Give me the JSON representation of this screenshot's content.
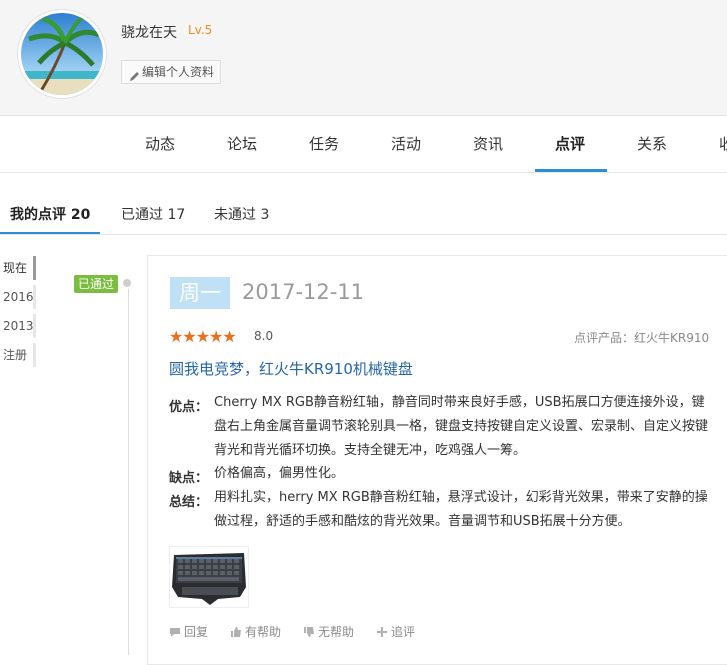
{
  "profile": {
    "username": "骁龙在天",
    "level": "Lv.5",
    "edit_label": "编辑个人资料"
  },
  "nav": {
    "tabs": [
      {
        "label": "动态"
      },
      {
        "label": "论坛"
      },
      {
        "label": "任务"
      },
      {
        "label": "活动"
      },
      {
        "label": "资讯"
      },
      {
        "label": "点评",
        "active": true
      },
      {
        "label": "关系"
      },
      {
        "label": "收"
      }
    ]
  },
  "subtabs": {
    "my_reviews": "我的点评 20",
    "approved": "已通过 17",
    "not_approved": "未通过 3"
  },
  "years": [
    "现在",
    "2016",
    "2013",
    "注册"
  ],
  "review": {
    "status": "已通过",
    "weekday": "周一",
    "date": "2017-12-11",
    "stars": "★★★★★",
    "rating": 8.0,
    "score": "8.0",
    "product_label": "点评产品：红火牛KR910",
    "title": "圆我电竞梦，红火牛KR910机械键盘",
    "pros_label": "优点：",
    "pros_text": "Cherry MX RGB静音粉红轴，静音同时带来良好手感，USB拓展口方便连接外设，键盘右上角金属音量调节滚轮别具一格，键盘支持按键自定义设置、宏录制、自定义按键背光和背光循环切换。支持全键无冲，吃鸡强人一筹。",
    "cons_label": "缺点：",
    "cons_text": "价格偏高，偏男性化。",
    "summary_label": "总结：",
    "summary_text": "用料扎实，herry MX RGB静音粉红轴，悬浮式设计，幻彩背光效果，带来了安静的操做过程，舒适的手感和酷炫的背光效果。音量调节和USB拓展十分方便。"
  },
  "actions": {
    "reply": "回复",
    "helpful": "有帮助",
    "not_helpful": "无帮助",
    "follow_up": "追评"
  },
  "colors": {
    "accent": "#2b8fd6",
    "link": "#2666a8",
    "star": "#ee6d1c",
    "level": "#f08a24",
    "badge_green": "#7bbd3f"
  }
}
